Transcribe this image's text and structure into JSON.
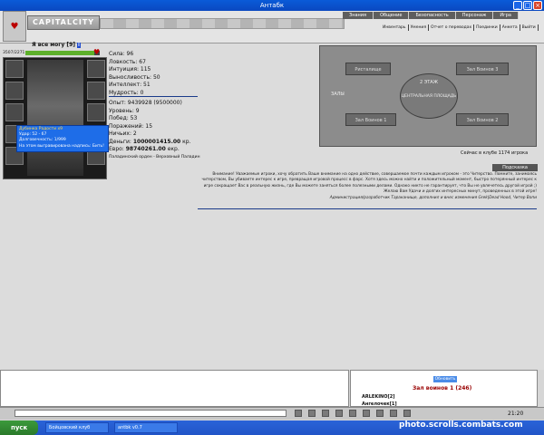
{
  "window": {
    "title": "Антабк"
  },
  "header": {
    "logo_text": "CAPITALCITY",
    "top_menu": [
      "Знания",
      "Общение",
      "Безопасность",
      "Персонаж",
      "Игра"
    ],
    "sub_menu": [
      "Инвентарь",
      "Умения",
      "Отчет о переводах",
      "Поединки",
      "Анкета",
      "Выйти"
    ]
  },
  "character": {
    "name": "Я все могу",
    "level": "[9]",
    "hp_text": "3507/2271",
    "hp_fraction": 0.93,
    "stats": [
      "Сила: 96",
      "Ловкость: 67",
      "Интуиция: 115",
      "Выносливость: 50",
      "Интеллект: 51",
      "Мудрость: 0"
    ],
    "stats2": [
      "Опыт: 9439928 (9500000)",
      "Уровень: 9",
      "Побед: 53",
      "Поражений: 15",
      "Ничьих: 2"
    ],
    "money_label": "Деньги:",
    "money_value": "1000001415.00",
    "money_unit": "кр.",
    "euro_label": "Евро:",
    "euro_value": "98740261.00",
    "euro_unit": "екр.",
    "order": "Паладинский орден - Верховный Паладин",
    "tooltip": [
      "Дубинка Радости х9",
      "Удар: 52 - 67",
      "Долговечность: 1/999",
      "На этом выгравирована надпись: Бить!"
    ]
  },
  "map": {
    "floor": "2 ЭТАЖ",
    "hall_label": "ЗАЛЫ",
    "center": "ЦЕНТРАЛЬНАЯ ПЛОЩАДЬ",
    "rooms": [
      "Ристалище",
      "Зал Воинов 3",
      "Зал Воинов 1",
      "Зал Воинов 2"
    ],
    "online_text": "Сейчас в клубе 1174 игрока"
  },
  "notice": {
    "header": "Подсказка",
    "body": "Внимание! Уважаемые игроки, хочу обратить Ваше внимание на одно действие, совершаемое почти каждым игроком - это Читерство. Помните, занимаясь читерством, Вы убиваете интерес к игре, превращая игровой процесс в фарс. Хотя здесь можно найти и положительный момент, быстро потерянный интерес к игре сокращает Вас в реальную жизнь, где Вы можете заняться более полезными делами. Однако никто не гарантирует, что Вы не увлечетесь другой игрой ;)",
    "line2": "Желаю Вам Удачи и долгих интересных минут, проведенных в этой игре!",
    "sig": "Администрация/разработчик Тараканище, дополнил и внес изменения Grek|Dead Hood, Читер Вопи"
  },
  "room": {
    "button": "Обновить",
    "title": "Зал воинов 1 (246)",
    "players": [
      "ARLEKINO[2]",
      "Ангелочек[1]"
    ]
  },
  "clock": "21:20",
  "taskbar": {
    "start": "пуск",
    "tasks": [
      "Бойцовский клуб",
      "antbk v0.7"
    ]
  },
  "watermark": "photo.scrolls.combats.com"
}
